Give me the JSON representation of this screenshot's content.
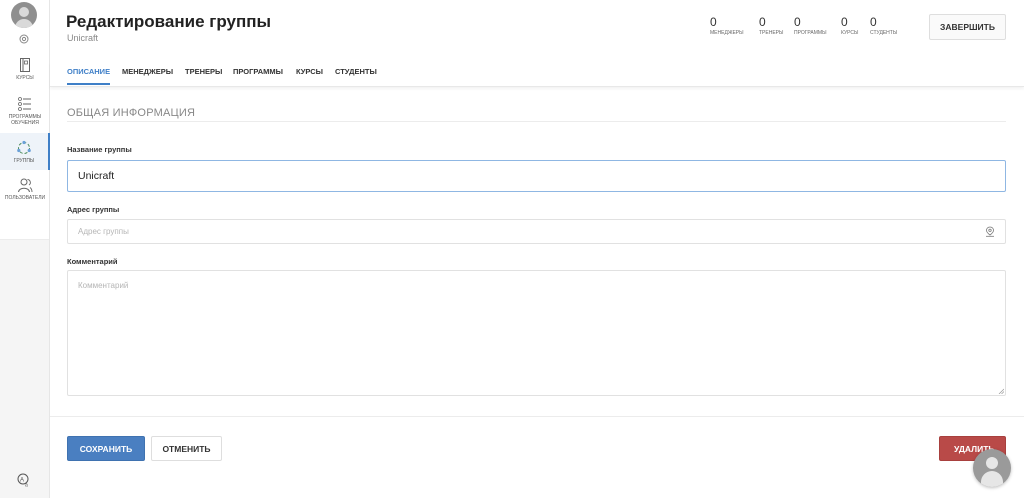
{
  "sidebar": {
    "items": [
      {
        "label": "Курсы",
        "icon": "courses-icon"
      },
      {
        "label": "Программы обучения",
        "icon": "programs-icon"
      },
      {
        "label": "Группы",
        "icon": "groups-icon"
      },
      {
        "label": "Пользователи",
        "icon": "users-icon"
      }
    ]
  },
  "header": {
    "title": "Редактирование группы",
    "subtitle": "Unicraft",
    "finish_label": "ЗАВЕРШИТЬ",
    "stats": [
      {
        "value": "0",
        "caption": "Менеджеры"
      },
      {
        "value": "0",
        "caption": "Тренеры"
      },
      {
        "value": "0",
        "caption": "Программы"
      },
      {
        "value": "0",
        "caption": "Курсы"
      },
      {
        "value": "0",
        "caption": "Студенты"
      }
    ]
  },
  "tabs": [
    {
      "label": "Описание",
      "active": true
    },
    {
      "label": "Менеджеры"
    },
    {
      "label": "Тренеры"
    },
    {
      "label": "Программы"
    },
    {
      "label": "Курсы"
    },
    {
      "label": "Студенты"
    }
  ],
  "form": {
    "section_title": "ОБЩАЯ ИНФОРМАЦИЯ",
    "name_label": "Название группы",
    "name_value": "Unicraft",
    "address_label": "Адрес группы",
    "address_placeholder": "Адрес группы",
    "comment_label": "Комментарий",
    "comment_placeholder": "Комментарий"
  },
  "actions": {
    "save_label": "СОХРАНИТЬ",
    "cancel_label": "ОТМЕНИТЬ",
    "delete_label": "УДАЛИТЬ"
  },
  "colors": {
    "accent": "#3f7fc7",
    "save": "#4a7fc1",
    "delete": "#b94a48"
  }
}
